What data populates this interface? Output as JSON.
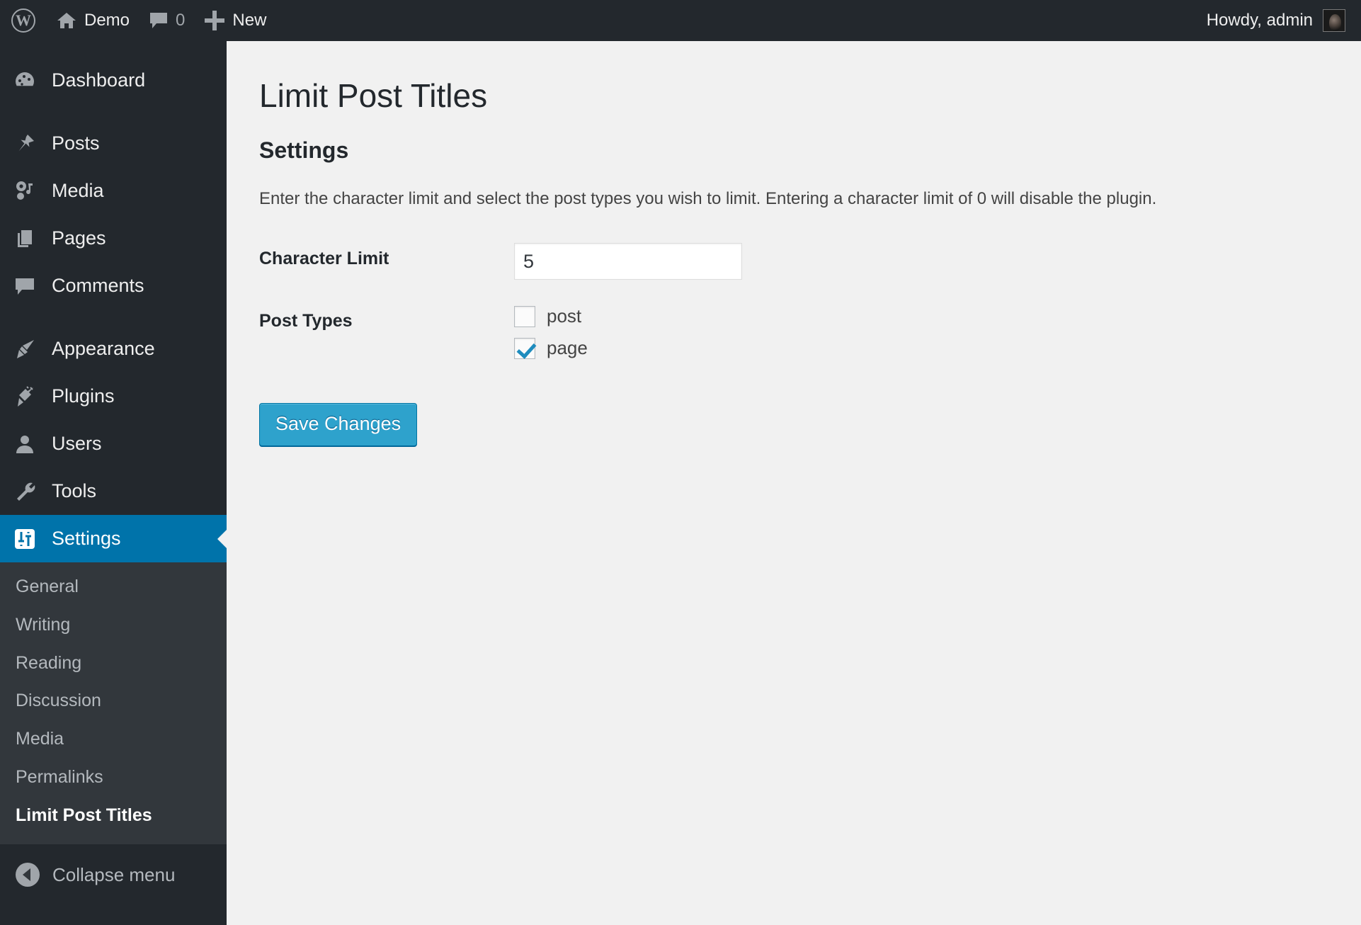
{
  "adminbar": {
    "logo_icon": "wordpress-logo-icon",
    "site_name": "Demo",
    "home_icon": "home-icon",
    "comments_icon": "comment-bubble-icon",
    "comments_count": "0",
    "new_icon": "plus-icon",
    "new_label": "New",
    "howdy": "Howdy, admin",
    "avatar_icon": "avatar"
  },
  "sidebar": {
    "items": [
      {
        "label": "Dashboard",
        "icon": "dashboard-icon"
      },
      {
        "label": "Posts",
        "icon": "pin-icon"
      },
      {
        "label": "Media",
        "icon": "media-icon"
      },
      {
        "label": "Pages",
        "icon": "pages-icon"
      },
      {
        "label": "Comments",
        "icon": "comment-bubble-icon"
      },
      {
        "label": "Appearance",
        "icon": "paintbrush-icon"
      },
      {
        "label": "Plugins",
        "icon": "plug-icon"
      },
      {
        "label": "Users",
        "icon": "user-icon"
      },
      {
        "label": "Tools",
        "icon": "wrench-icon"
      },
      {
        "label": "Settings",
        "icon": "settings-sliders-icon",
        "current": true
      }
    ],
    "submenu": [
      {
        "label": "General"
      },
      {
        "label": "Writing"
      },
      {
        "label": "Reading"
      },
      {
        "label": "Discussion"
      },
      {
        "label": "Media"
      },
      {
        "label": "Permalinks"
      },
      {
        "label": "Limit Post Titles",
        "current": true
      }
    ],
    "collapse_label": "Collapse menu",
    "collapse_icon": "arrow-left-circle-icon"
  },
  "main": {
    "page_title": "Limit Post Titles",
    "section_title": "Settings",
    "description": "Enter the character limit and select the post types you wish to limit. Entering a character limit of 0 will disable the plugin.",
    "character_limit": {
      "label": "Character Limit",
      "value": "5"
    },
    "post_types": {
      "label": "Post Types",
      "options": [
        {
          "label": "post",
          "checked": false
        },
        {
          "label": "page",
          "checked": true
        }
      ]
    },
    "save_label": "Save Changes"
  },
  "colors": {
    "admin_dark": "#23282d",
    "submenu_dark": "#32373c",
    "accent_blue": "#0073aa",
    "button_blue": "#2ea2cc",
    "content_bg": "#f1f1f1",
    "checkbox_check": "#1e8cbe"
  }
}
